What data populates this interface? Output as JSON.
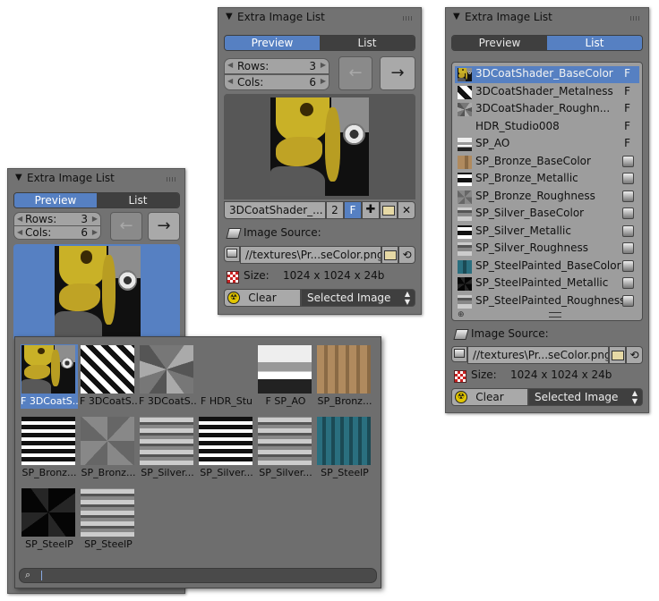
{
  "panel_title": "Extra Image List",
  "tabs": {
    "preview": "Preview",
    "list": "List"
  },
  "rows_label": "Rows:",
  "rows_value": "3",
  "cols_label": "Cols:",
  "cols_value": "6",
  "arrow_prev": "←",
  "arrow_next": "→",
  "image_name": "3DCoatShader_...",
  "user_count": "2",
  "fake_user": "F",
  "image_source_label": "Image Source:",
  "image_path": "//textures\\Pr...seColor.png",
  "size_label": "Size:",
  "size_value": "1024 x 1024 x 24b",
  "clear_label": "Clear",
  "selected_image_label": "Selected Image",
  "list_items": [
    {
      "name": "3DCoatShader_BaseColor",
      "flag": "F",
      "active": true
    },
    {
      "name": "3DCoatShader_Metalness",
      "flag": "F"
    },
    {
      "name": "3DCoatShader_Roughn...",
      "flag": "F"
    },
    {
      "name": "HDR_Studio008",
      "flag": "F"
    },
    {
      "name": "SP_AO",
      "flag": "F"
    },
    {
      "name": "SP_Bronze_BaseColor",
      "flag": ""
    },
    {
      "name": "SP_Bronze_Metallic",
      "flag": ""
    },
    {
      "name": "SP_Bronze_Roughness",
      "flag": ""
    },
    {
      "name": "SP_Silver_BaseColor",
      "flag": ""
    },
    {
      "name": "SP_Silver_Metallic",
      "flag": ""
    },
    {
      "name": "SP_Silver_Roughness",
      "flag": ""
    },
    {
      "name": "SP_SteelPainted_BaseColor",
      "flag": ""
    },
    {
      "name": "SP_SteelPainted_Metallic",
      "flag": ""
    },
    {
      "name": "SP_SteelPainted_Roughness",
      "flag": ""
    }
  ],
  "popup_items": [
    "F 3DCoatS...",
    "F 3DCoatS...",
    "F 3DCoatS...",
    "F HDR_Stu",
    "F SP_AO",
    "SP_Bronz...",
    "SP_Bronz...",
    "SP_Bronz...",
    "SP_Silver...",
    "SP_Silver...",
    "SP_Silver...",
    "SP_SteelP",
    "SP_SteelP",
    "SP_SteelP"
  ],
  "colors": {
    "accent": "#5680c2",
    "panel": "#727272",
    "yellow": "#c9b127"
  }
}
